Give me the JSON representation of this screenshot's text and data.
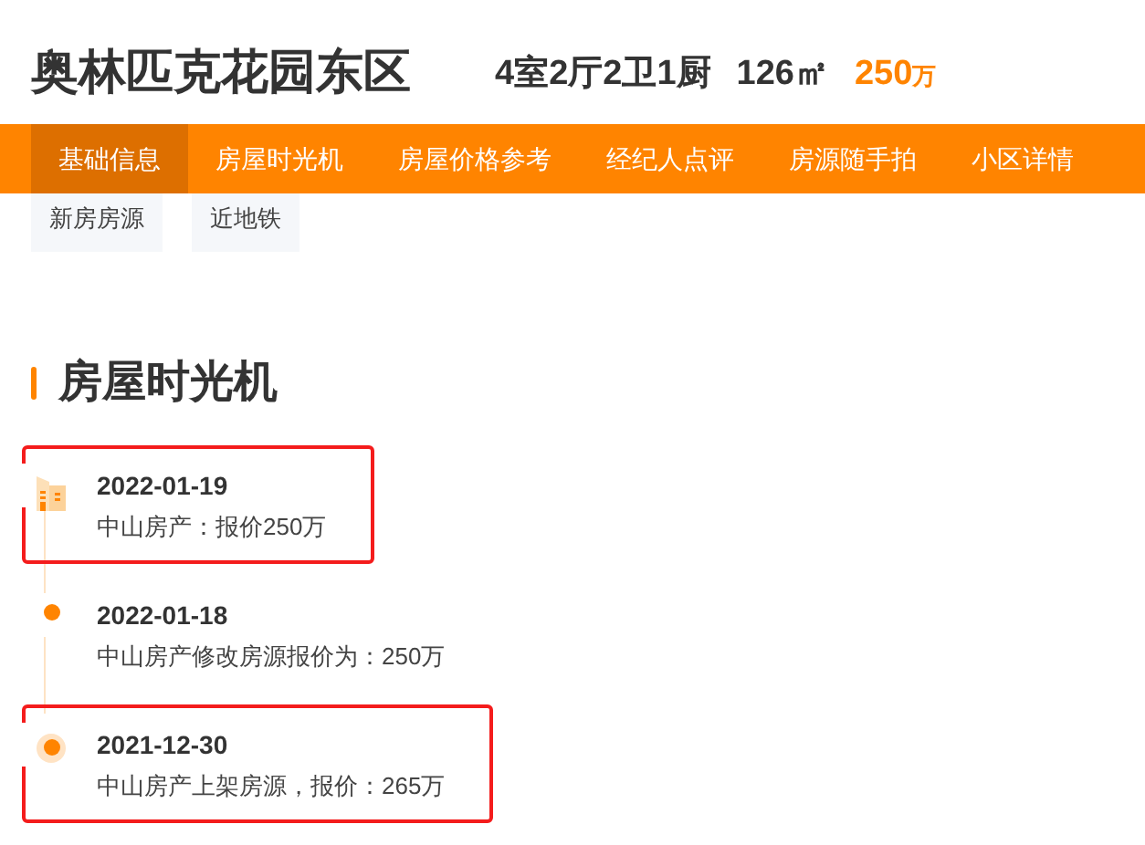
{
  "header": {
    "title": "奥林匹克花园东区",
    "layout": "4室2厅2卫1厨",
    "area": "126㎡",
    "price": "250",
    "price_unit": "万"
  },
  "tabs": [
    {
      "label": "基础信息",
      "selected": true
    },
    {
      "label": "房屋时光机",
      "selected": false
    },
    {
      "label": "房屋价格参考",
      "selected": false
    },
    {
      "label": "经纪人点评",
      "selected": false
    },
    {
      "label": "房源随手拍",
      "selected": false
    },
    {
      "label": "小区详情",
      "selected": false
    }
  ],
  "tags": [
    "新房房源",
    "近地铁"
  ],
  "section": {
    "title": "房屋时光机"
  },
  "timeline": [
    {
      "kind": "current",
      "date": "2022-01-19",
      "text": "中山房产：报价250万",
      "highlighted": true
    },
    {
      "kind": "dot",
      "date": "2022-01-18",
      "text": "中山房产修改房源报价为：250万",
      "highlighted": false
    },
    {
      "kind": "origin",
      "date": "2021-12-30",
      "text": "中山房产上架房源，报价：265万",
      "highlighted": true
    }
  ]
}
